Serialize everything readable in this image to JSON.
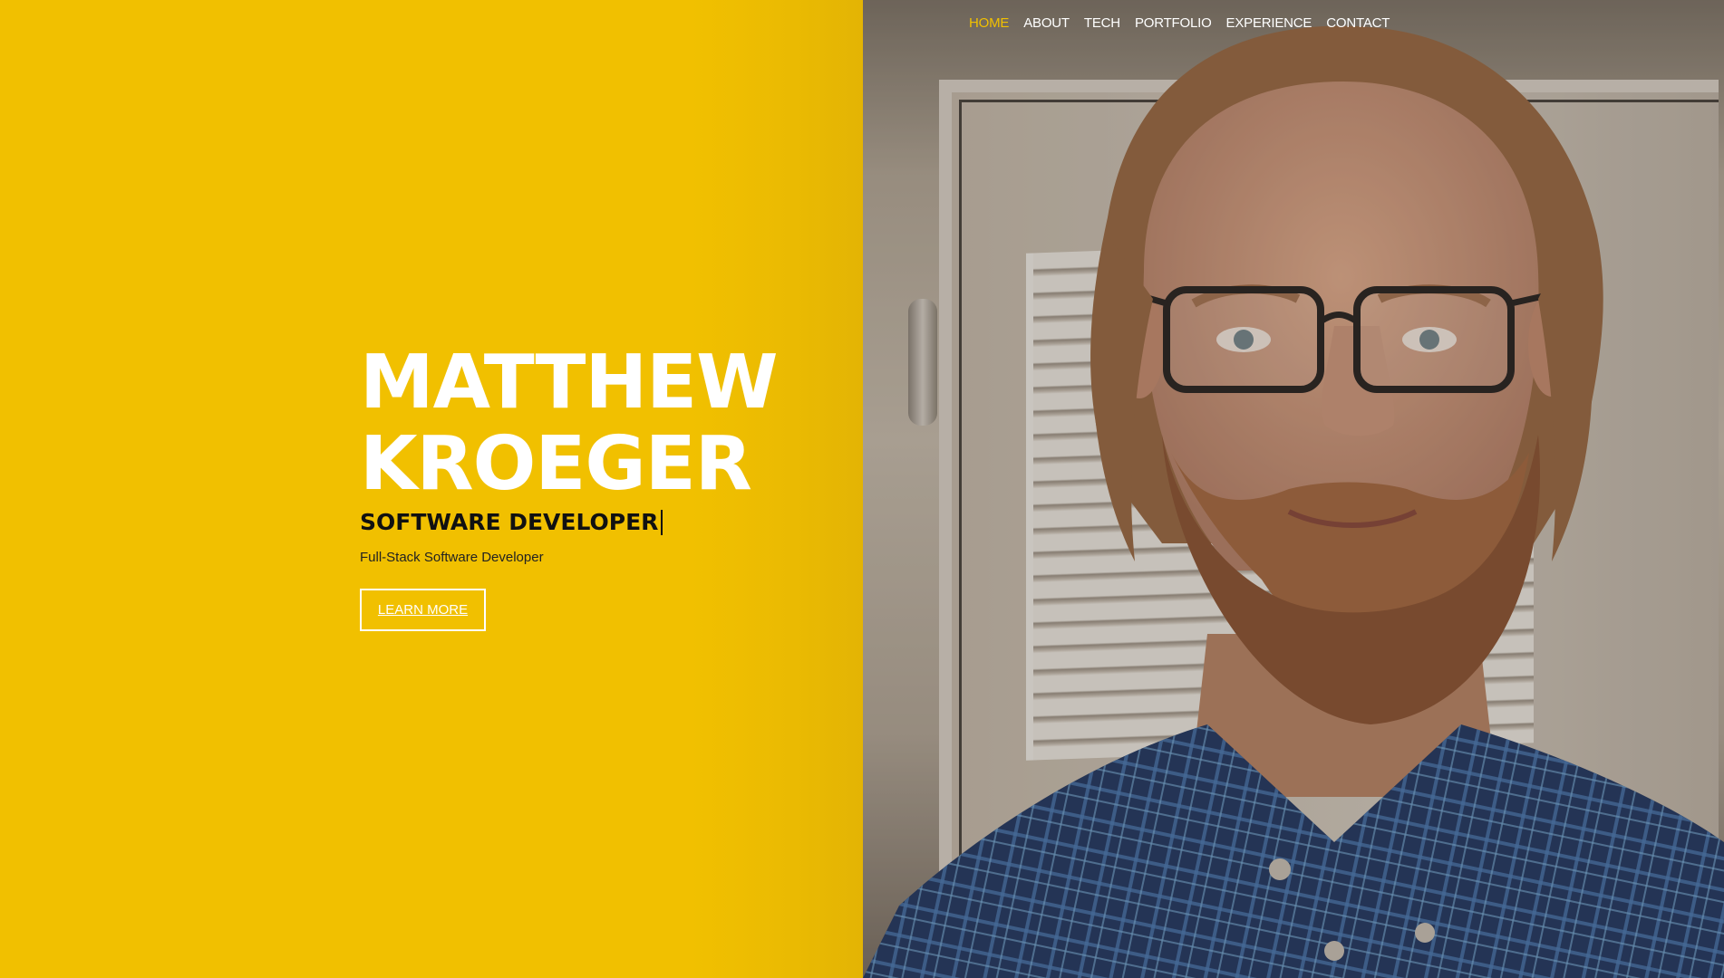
{
  "nav": {
    "items": [
      {
        "label": "HOME",
        "active": true
      },
      {
        "label": "ABOUT",
        "active": false
      },
      {
        "label": "TECH",
        "active": false
      },
      {
        "label": "PORTFOLIO",
        "active": false
      },
      {
        "label": "EXPERIENCE",
        "active": false
      },
      {
        "label": "CONTACT",
        "active": false
      }
    ]
  },
  "hero": {
    "first_name": "MATTHEW",
    "last_name": "KROEGER",
    "role": "SOFTWARE DEVELOPER",
    "tagline": "Full-Stack Software Developer",
    "cta_label": "LEARN MORE"
  },
  "colors": {
    "accent": "#f1c000",
    "text_light": "#ffffff",
    "text_dark": "#111111"
  },
  "icons": [
    "text-cursor-icon"
  ]
}
